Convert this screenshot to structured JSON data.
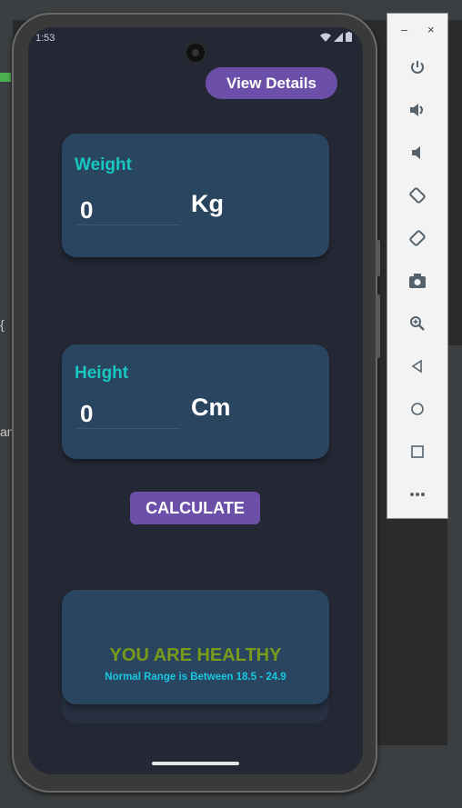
{
  "status_bar": {
    "time": "1:53"
  },
  "header": {
    "view_details_label": "View Details"
  },
  "weight_card": {
    "label": "Weight",
    "value": "0",
    "unit": "Kg"
  },
  "height_card": {
    "label": "Height",
    "value": "0",
    "unit": "Cm"
  },
  "actions": {
    "calculate_label": "CALCULATE"
  },
  "result": {
    "status": "YOU ARE HEALTHY",
    "range_text": "Normal Range is Between 18.5 - 24.9"
  },
  "emulator_panel": {
    "minimize": "–",
    "close": "×",
    "tools": [
      "power-icon",
      "volume-up-icon",
      "volume-down-icon",
      "rotate-left-icon",
      "rotate-right-icon",
      "camera-icon",
      "zoom-icon",
      "back-icon",
      "home-icon",
      "overview-icon",
      "more-icon"
    ]
  },
  "colors": {
    "accent": "#6c4fa8",
    "card": "#2a4560",
    "label_teal": "#18c7c0",
    "healthy_green": "#7a9a1a",
    "screen_bg": "#232834"
  }
}
